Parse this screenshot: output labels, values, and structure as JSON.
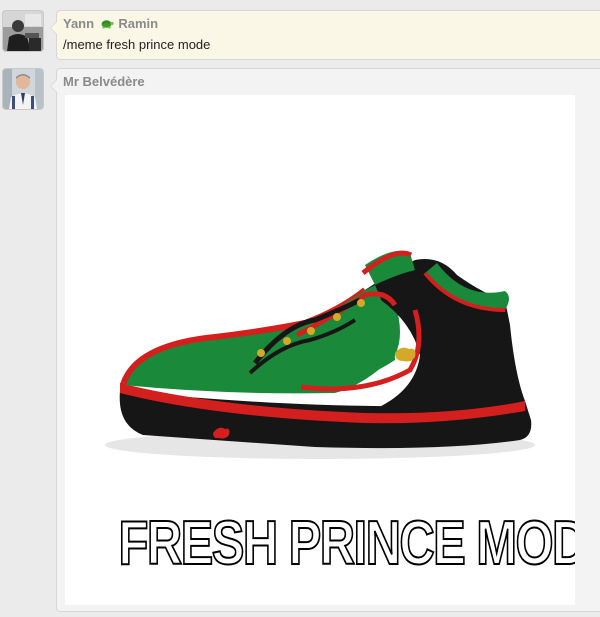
{
  "messages": [
    {
      "author_first": "Yann",
      "author_second": "Ramin",
      "author_icon": "turtle-icon",
      "text": "/meme fresh prince mode",
      "bubble_color": "#fbf7e7"
    },
    {
      "author": "Mr Belvédère",
      "meme_caption": "FRESH PRINCE MODE",
      "image_subject": "green-black-red-sneaker",
      "bubble_color": "#f3f3f3"
    }
  ],
  "colors": {
    "background": "#ebebeb",
    "author_text": "#8a8a8a",
    "body_text": "#1f1f1f",
    "shoe_green": "#1a8a3a",
    "shoe_red": "#d3201f",
    "shoe_black": "#161616",
    "shoe_gold": "#d4a92a"
  }
}
